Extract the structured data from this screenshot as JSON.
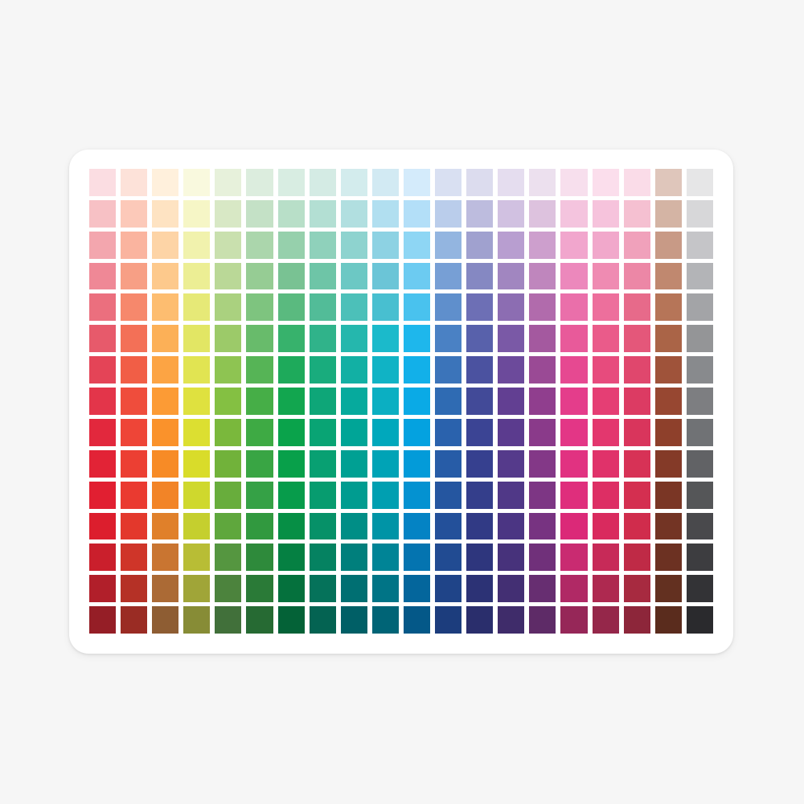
{
  "palette": {
    "rows": [
      [
        "#fbdde2",
        "#fde2d9",
        "#fff0dc",
        "#f9f9de",
        "#e7f1db",
        "#dcedde",
        "#d8ede2",
        "#d4ebe4",
        "#d3eced",
        "#d2eaf3",
        "#d4ebfb",
        "#d9e0f2",
        "#dcdcee",
        "#e5ddef",
        "#ece0ee",
        "#f7dfed",
        "#fbdeec",
        "#fadce8",
        "#dfc6bb",
        "#e6e6e7"
      ],
      [
        "#f7c1c5",
        "#fcc9b9",
        "#fee3c2",
        "#f6f6c6",
        "#d8e8c5",
        "#c4e1c6",
        "#b8dfc8",
        "#b3dfd3",
        "#b1dfe0",
        "#b1dff0",
        "#b3dff8",
        "#bacdeb",
        "#bdbcde",
        "#d1c1e1",
        "#ddc2de",
        "#f4c4de",
        "#f6c3dc",
        "#f5c0d1",
        "#d4b4a4",
        "#d7d7d9"
      ],
      [
        "#f3a6ae",
        "#fab49f",
        "#fdd4a6",
        "#f1f2ad",
        "#c9e0ae",
        "#abd6ac",
        "#96d0ac",
        "#8fd1bb",
        "#8ed3cf",
        "#8dd2e3",
        "#8ed6f4",
        "#93b5e0",
        "#a0a1cf",
        "#b89ed0",
        "#cd9fcd",
        "#f1a6cd",
        "#f1a8cb",
        "#f0a1bb",
        "#c89a86",
        "#c5c5c8"
      ],
      [
        "#ef8896",
        "#f79f85",
        "#fdc98c",
        "#ecee94",
        "#bad897",
        "#96cc94",
        "#79c293",
        "#6ec5a7",
        "#6cc8c4",
        "#6bc5d7",
        "#6ccbf1",
        "#779fd5",
        "#8588c2",
        "#a186c0",
        "#bf86bd",
        "#ec88bc",
        "#ef8bb2",
        "#ec87a6",
        "#c0886f",
        "#b3b4b7"
      ],
      [
        "#eb6f7e",
        "#f6886c",
        "#fdbd70",
        "#e6e977",
        "#aad17f",
        "#7ec47f",
        "#5aba7f",
        "#52bc98",
        "#4cc0b9",
        "#48bfd0",
        "#49c2ee",
        "#5f8fcc",
        "#6d6fb5",
        "#8c6db2",
        "#b16bac",
        "#ea6faa",
        "#ed6f9c",
        "#e76a8a",
        "#b67558",
        "#a3a4a7"
      ],
      [
        "#e75a6b",
        "#f37057",
        "#fcb057",
        "#e2e664",
        "#9cca69",
        "#68bb6b",
        "#37b26c",
        "#30b38a",
        "#25b7ad",
        "#1bbacb",
        "#1eb7ec",
        "#4a81c4",
        "#5861ab",
        "#7a59a6",
        "#a4599f",
        "#e85a9a",
        "#ea5b8a",
        "#e4577a",
        "#aa6447",
        "#949597"
      ],
      [
        "#e44457",
        "#f15e46",
        "#fca444",
        "#e1e452",
        "#8ec452",
        "#56b456",
        "#1eaa5b",
        "#19ac7d",
        "#12b0a4",
        "#10b3c5",
        "#12b0e9",
        "#3b74ba",
        "#4b52a0",
        "#6c4a9b",
        "#9a4a95",
        "#e64991",
        "#e74b7d",
        "#e0476d",
        "#9f533a",
        "#888a8d"
      ],
      [
        "#e3354a",
        "#ef4d3c",
        "#fc9b35",
        "#dfe13f",
        "#84c042",
        "#46ae47",
        "#12a64f",
        "#0ea678",
        "#06aa9d",
        "#0bafc2",
        "#0aaae6",
        "#2f6bb3",
        "#424a98",
        "#623f92",
        "#903e8e",
        "#e43d8b",
        "#e53e74",
        "#dc3b63",
        "#974731",
        "#7d7e81"
      ],
      [
        "#e2283d",
        "#ee4537",
        "#fa922b",
        "#dcdf31",
        "#7ab83c",
        "#3eaa44",
        "#0aa34b",
        "#09a474",
        "#00a597",
        "#00a8bc",
        "#04a2e0",
        "#2a62ad",
        "#3b4494",
        "#5b3b8e",
        "#8a3a8a",
        "#e33686",
        "#e3376e",
        "#d9355c",
        "#8e402b",
        "#707275"
      ],
      [
        "#e22336",
        "#ec3f33",
        "#f78b26",
        "#d9dc2a",
        "#71b23a",
        "#39a544",
        "#08a04a",
        "#08a072",
        "#00a093",
        "#00a3b6",
        "#039bd9",
        "#275ca7",
        "#36408f",
        "#553a8b",
        "#833887",
        "#e13281",
        "#e0326a",
        "#d73256",
        "#843a28",
        "#616265"
      ],
      [
        "#e11f31",
        "#ea3a30",
        "#f28427",
        "#cfd82d",
        "#68ad3c",
        "#35a146",
        "#079c4b",
        "#079c6f",
        "#009c90",
        "#009fb1",
        "#0492d1",
        "#2556a0",
        "#343e8b",
        "#503887",
        "#7d3684",
        "#df2e7c",
        "#dd2e64",
        "#d42f50",
        "#7a3625",
        "#555658"
      ],
      [
        "#dc1e2d",
        "#e3382c",
        "#e0802a",
        "#c5cf2e",
        "#5fa73d",
        "#31993f",
        "#068f45",
        "#069168",
        "#008e86",
        "#0094a6",
        "#0483c4",
        "#23509a",
        "#313a85",
        "#4b3583",
        "#773381",
        "#db2978",
        "#d92a5e",
        "#d02c4c",
        "#733424",
        "#49494c"
      ],
      [
        "#ca1f2c",
        "#cf3529",
        "#c97531",
        "#b8bd35",
        "#559640",
        "#2e8a3b",
        "#058042",
        "#058261",
        "#007f7c",
        "#008496",
        "#0474b0",
        "#214b92",
        "#2e367d",
        "#47327b",
        "#70307a",
        "#c92b71",
        "#c72a58",
        "#bf2a46",
        "#6c3122",
        "#3d3d40"
      ],
      [
        "#b11f2a",
        "#b53126",
        "#ab6a35",
        "#a0a538",
        "#4c833d",
        "#2a7a37",
        "#05713d",
        "#05725a",
        "#006f72",
        "#007486",
        "#04669c",
        "#1f4488",
        "#2c3275",
        "#432f73",
        "#672e71",
        "#b02965",
        "#ae2950",
        "#a72a40",
        "#633020",
        "#333336"
      ],
      [
        "#951e26",
        "#9a2c24",
        "#8e5d33",
        "#878c36",
        "#41703a",
        "#266a33",
        "#046237",
        "#046352",
        "#005f66",
        "#006476",
        "#045888",
        "#1c3d7d",
        "#2a2e6c",
        "#3f2c6a",
        "#5e2b67",
        "#962758",
        "#95274a",
        "#8d263a",
        "#5a2c1d",
        "#2a2a2d"
      ]
    ]
  }
}
